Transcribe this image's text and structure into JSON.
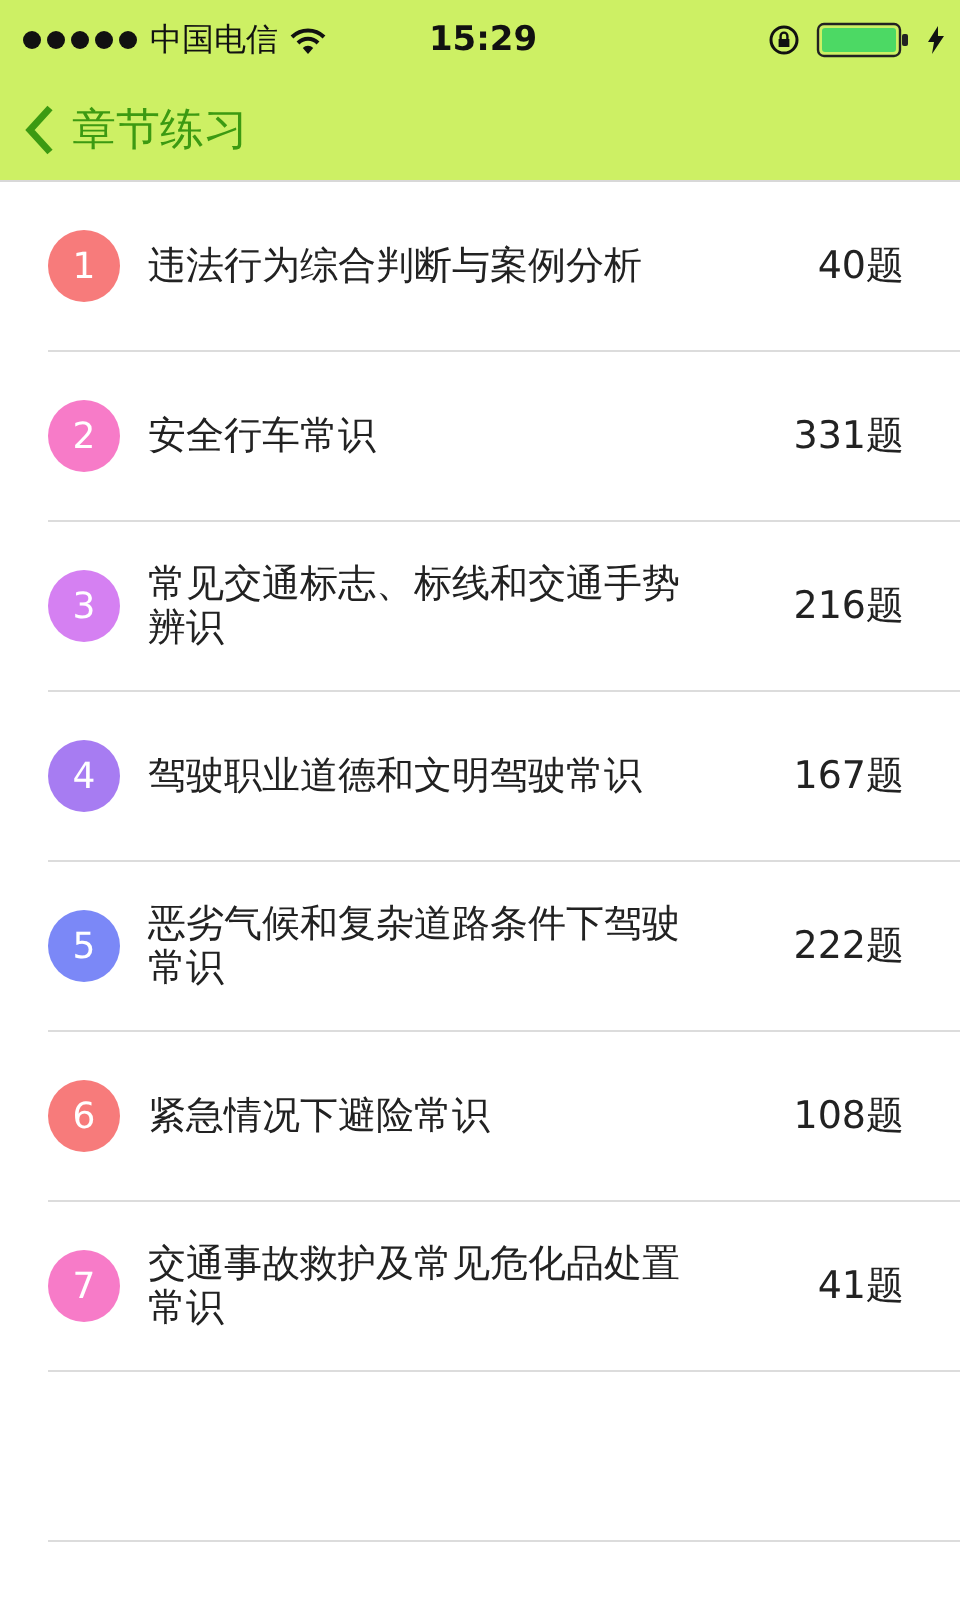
{
  "status_bar": {
    "carrier": "中国电信",
    "time": "15:29"
  },
  "nav": {
    "title": "章节练习"
  },
  "chapters": [
    {
      "number": "1",
      "title": "违法行为综合判断与案例分析",
      "count": "40题",
      "color": "#f77b7b"
    },
    {
      "number": "2",
      "title": "安全行车常识",
      "count": "331题",
      "color": "#f77bc8"
    },
    {
      "number": "3",
      "title": "常见交通标志、标线和交通手势辨识",
      "count": "216题",
      "color": "#d580f2"
    },
    {
      "number": "4",
      "title": "驾驶职业道德和文明驾驶常识",
      "count": "167题",
      "color": "#a77cf2"
    },
    {
      "number": "5",
      "title": "恶劣气候和复杂道路条件下驾驶常识",
      "count": "222题",
      "color": "#7b88f7"
    },
    {
      "number": "6",
      "title": "紧急情况下避险常识",
      "count": "108题",
      "color": "#f77b7b"
    },
    {
      "number": "7",
      "title": "交通事故救护及常见危化品处置常识",
      "count": "41题",
      "color": "#f77bc8"
    }
  ]
}
